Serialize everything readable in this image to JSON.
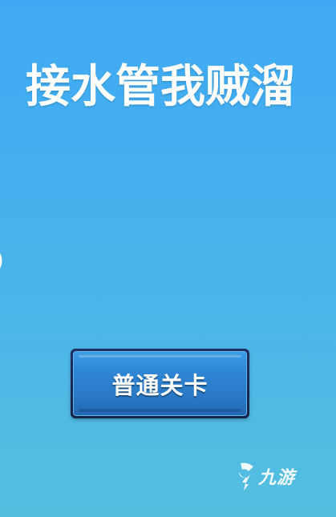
{
  "game": {
    "title": "接水管我贼溜",
    "edge_glyph": ")",
    "level_button_label": "普通关卡"
  },
  "watermark": {
    "logo_icon": "nine-game-logo-icon",
    "text": "九游"
  },
  "colors": {
    "background_top": "#3fa9f5",
    "background_bottom": "#55bfdf",
    "button_fill": "#2a79c6",
    "button_border": "#1e2f63",
    "text": "#ffffff"
  }
}
